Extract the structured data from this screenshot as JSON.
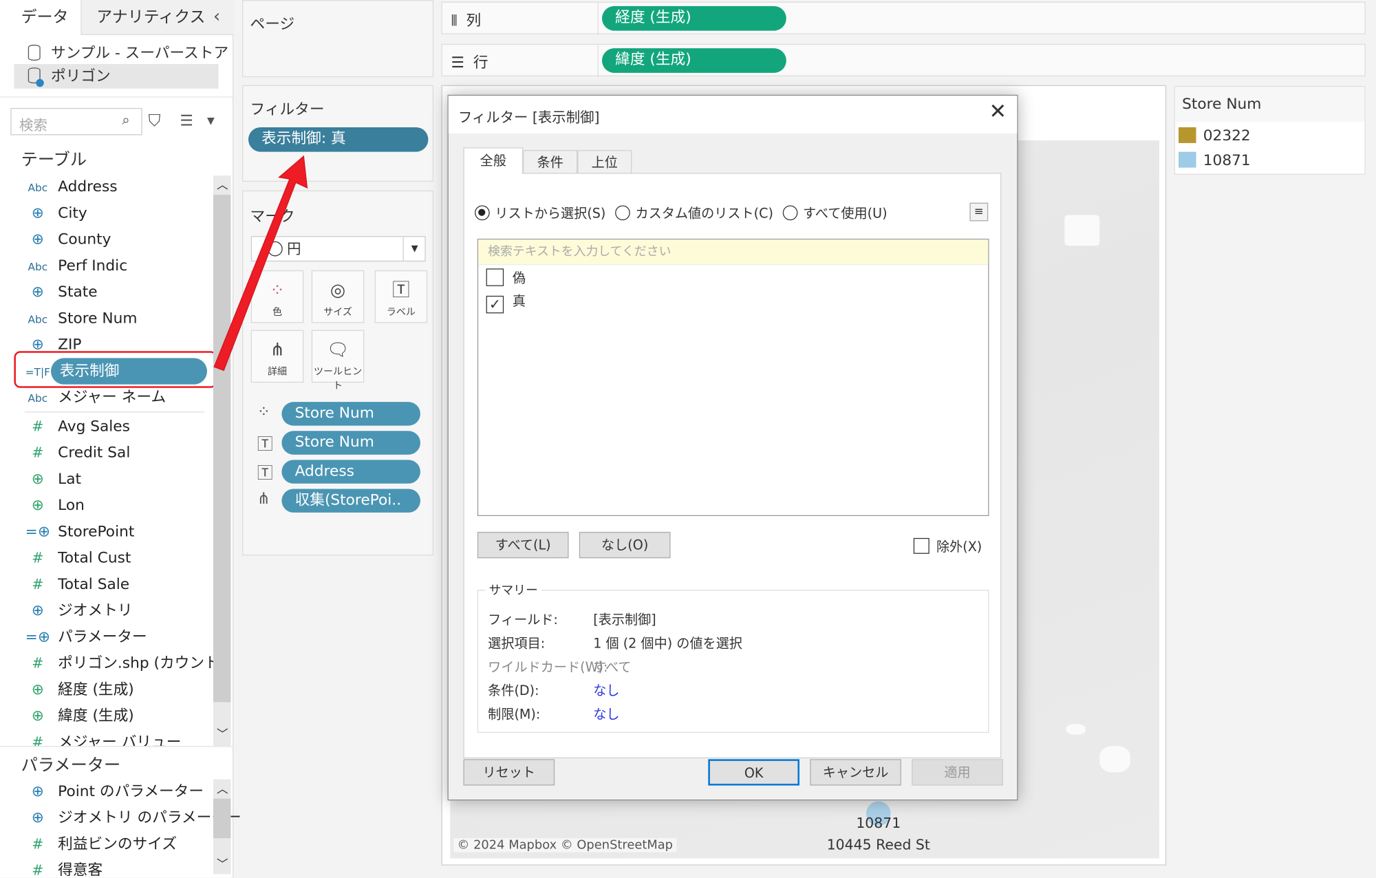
{
  "left_panel": {
    "tabs": [
      {
        "label": "データ",
        "active": true
      },
      {
        "label": "アナリティクス",
        "active": false
      }
    ],
    "collapse_icon": "chevron-left-icon",
    "data_sources": [
      {
        "label": "サンプル - スーパーストア",
        "icon": "database-icon"
      },
      {
        "label": "ポリゴン",
        "icon": "database-active-icon",
        "selected": true
      }
    ],
    "search_placeholder": "検索",
    "tables_heading": "テーブル",
    "fields": [
      {
        "icon": "Abc",
        "label": "Address"
      },
      {
        "icon": "globe",
        "label": "City"
      },
      {
        "icon": "globe",
        "label": "County"
      },
      {
        "icon": "Abc",
        "label": "Perf Indic"
      },
      {
        "icon": "globe",
        "label": "State"
      },
      {
        "icon": "Abc",
        "label": "Store Num"
      },
      {
        "icon": "globe",
        "label": "ZIP"
      },
      {
        "icon": "=T|F",
        "label": "表示制御",
        "highlighted": true
      },
      {
        "icon": "Abc",
        "label": "メジャー ネーム"
      },
      {
        "icon": "#",
        "label": "Avg Sales"
      },
      {
        "icon": "#",
        "label": "Credit Sal"
      },
      {
        "icon": "gglobe",
        "label": "Lat"
      },
      {
        "icon": "gglobe",
        "label": "Lon"
      },
      {
        "icon": "=globe",
        "label": "StorePoint"
      },
      {
        "icon": "#",
        "label": "Total Cust"
      },
      {
        "icon": "#",
        "label": "Total Sale"
      },
      {
        "icon": "globe",
        "label": "ジオメトリ"
      },
      {
        "icon": "=globe",
        "label": "パラメーター"
      },
      {
        "icon": "#",
        "label": "ポリゴン.shp (カウント)"
      },
      {
        "icon": "gglobe",
        "label": "経度 (生成)"
      },
      {
        "icon": "gglobe",
        "label": "緯度 (生成)"
      },
      {
        "icon": "#",
        "label": "メジャー バリュー"
      }
    ],
    "parameters_heading": "パラメーター",
    "parameters": [
      {
        "icon": "globe",
        "label": "Point のパラメーター"
      },
      {
        "icon": "globe",
        "label": "ジオメトリ のパラメーター"
      },
      {
        "icon": "#",
        "label": "利益ビンのサイズ"
      },
      {
        "icon": "#",
        "label": "得意客"
      }
    ]
  },
  "pages": {
    "title": "ページ"
  },
  "filters": {
    "title": "フィルター",
    "pill": "表示制御: 真"
  },
  "marks": {
    "title": "マーク",
    "type": "円",
    "cards": [
      {
        "label": "色",
        "icon": "color-icon"
      },
      {
        "label": "サイズ",
        "icon": "size-icon"
      },
      {
        "label": "ラベル",
        "icon": "label-icon"
      },
      {
        "label": "詳細",
        "icon": "detail-icon"
      },
      {
        "label": "ツールヒント",
        "icon": "tooltip-icon"
      }
    ],
    "pills": [
      {
        "icon": "color-icon",
        "label": "Store Num"
      },
      {
        "icon": "label-icon",
        "label": "Store Num"
      },
      {
        "icon": "label-icon",
        "label": "Address"
      },
      {
        "icon": "detail-icon",
        "label": "収集(StorePoi.."
      }
    ]
  },
  "shelves": {
    "columns": {
      "label": "列",
      "pill": "経度 (生成)"
    },
    "rows": {
      "label": "行",
      "pill": "緯度 (生成)"
    }
  },
  "legend": {
    "title": "Store Num",
    "items": [
      {
        "label": "02322",
        "color": "#b8962e"
      },
      {
        "label": "10871",
        "color": "#9dcbe8"
      }
    ]
  },
  "map": {
    "mark_label_1": "10871",
    "mark_label_2": "10445 Reed St",
    "attribution": "© 2024 Mapbox © OpenStreetMap"
  },
  "dialog": {
    "title": "フィルター [表示制御]",
    "tabs": [
      "全般",
      "条件",
      "上位"
    ],
    "radios": [
      {
        "label": "リストから選択(S)",
        "checked": true
      },
      {
        "label": "カスタム値のリスト(C)",
        "checked": false
      },
      {
        "label": "すべて使用(U)",
        "checked": false
      }
    ],
    "search_placeholder": "検索テキストを入力してください",
    "values": [
      {
        "label": "偽",
        "checked": false
      },
      {
        "label": "真",
        "checked": true
      }
    ],
    "all_button": "すべて(L)",
    "none_button": "なし(O)",
    "exclude_label": "除外(X)",
    "summary": {
      "title": "サマリー",
      "rows": [
        {
          "key": "フィールド:",
          "value": "[表示制御]"
        },
        {
          "key": "選択項目:",
          "value": "1 個 (2 個中) の値を選択"
        },
        {
          "key": "ワイルドカード(W):",
          "value": "すべて"
        },
        {
          "key": "条件(D):",
          "value": "なし"
        },
        {
          "key": "制限(M):",
          "value": "なし"
        }
      ]
    },
    "reset_button": "リセット",
    "ok_button": "OK",
    "cancel_button": "キャンセル",
    "apply_button": "適用"
  },
  "colors": {
    "shelf_pill": "#13a67c",
    "dim_pill": "#4a95b3",
    "filter_pill": "#3a7f9c",
    "annotation": "#ee1c25"
  }
}
